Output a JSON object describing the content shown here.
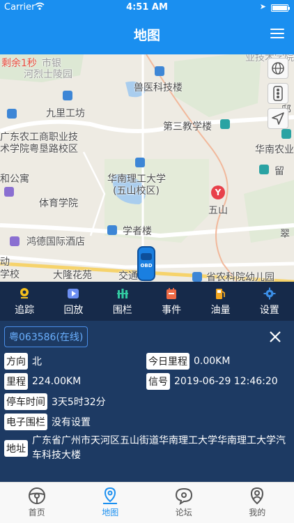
{
  "status_bar": {
    "carrier": "Carrier",
    "time": "4:51 AM"
  },
  "nav": {
    "title": "地图"
  },
  "map": {
    "countdown": "剩余1秒",
    "labels": {
      "bank": "市银",
      "hexing_park": "河烈士陵园",
      "vet_tech": "兽医科技楼",
      "jiuli": "九里工坊",
      "teaching3": "第三教学楼",
      "gd_agri_college_1": "广东农工商职业技",
      "gd_agri_college_2": "术学院粤垦路校区",
      "south_agri": "华南农业",
      "scut_1": "华南理工大学",
      "scut_2": "(五山校区)",
      "apartment": "和公寓",
      "pe_college": "体育学院",
      "wushan": "五山",
      "scholar": "学者楼",
      "hongde_hotel": "鸿德国际酒店",
      "school_1": "动",
      "school_2": "学校",
      "dalong": "大隆花苑",
      "jiaotong": "交通",
      "kindergarten": "省农科院幼儿园",
      "study_abroad": "留",
      "cui": "翠",
      "top_right": "业技术学院",
      "right_edge": "邸"
    }
  },
  "toolbar": {
    "items": [
      {
        "label": "追踪",
        "icon": "location-pin-icon"
      },
      {
        "label": "回放",
        "icon": "play-icon"
      },
      {
        "label": "围栏",
        "icon": "fence-icon"
      },
      {
        "label": "事件",
        "icon": "event-icon"
      },
      {
        "label": "油量",
        "icon": "fuel-icon"
      },
      {
        "label": "设置",
        "icon": "gear-icon"
      }
    ]
  },
  "vehicle": {
    "plate": "粤063586(在线)",
    "direction_label": "方向",
    "direction": "北",
    "today_mileage_label": "今日里程",
    "today_mileage": "0.00KM",
    "mileage_label": "里程",
    "mileage": "224.00KM",
    "signal_label": "信号",
    "signal": "2019-06-29 12:46:20",
    "parking_label": "停车时间",
    "parking": "3天5时32分",
    "fence_label": "电子围栏",
    "fence": "没有设置",
    "address_label": "地址",
    "address": "广东省广州市天河区五山街道华南理工大学华南理工大学汽车科技大楼"
  },
  "car_marker": "OBD",
  "metro_symbol": "Y",
  "tabbar": {
    "items": [
      {
        "label": "首页",
        "icon": "steering-wheel-icon",
        "active": false
      },
      {
        "label": "地图",
        "icon": "map-pin-icon",
        "active": true
      },
      {
        "label": "论坛",
        "icon": "chat-bubble-icon",
        "active": false
      },
      {
        "label": "我的",
        "icon": "profile-icon",
        "active": false
      }
    ]
  },
  "colors": {
    "primary": "#1a8ff0",
    "panel": "#1d3a63",
    "toolbar": "#162a4a",
    "alert": "#e84a3c"
  }
}
